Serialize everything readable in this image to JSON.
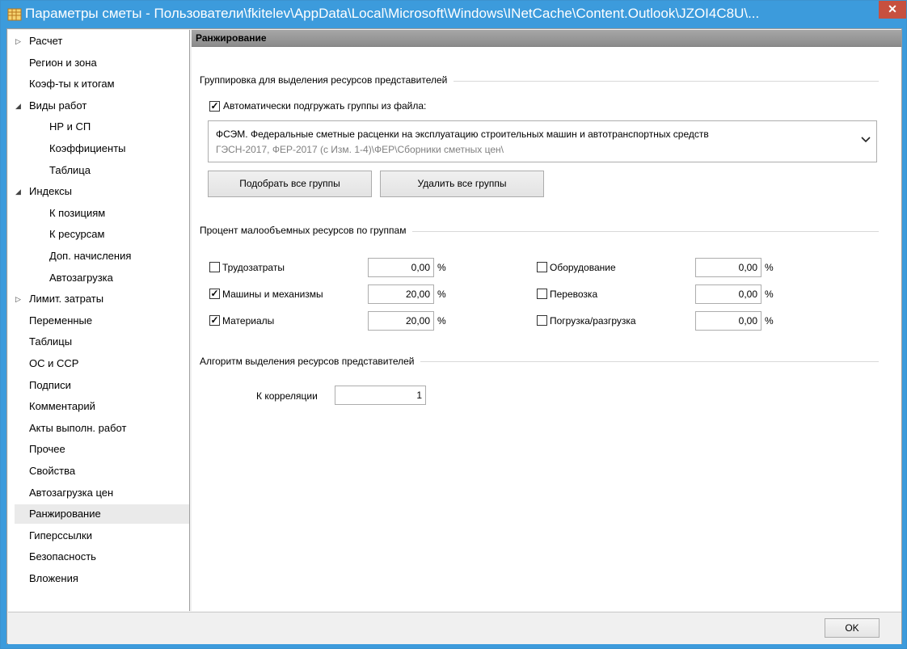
{
  "window": {
    "title": "Параметры сметы - Пользователи\\fkitelev\\AppData\\Local\\Microsoft\\Windows\\INetCache\\Content.Outlook\\JZOI4C8U\\...",
    "close_glyph": "✕",
    "app_icon": "table-app-icon",
    "accent_color": "#3c9bdc",
    "close_color": "#c7503f"
  },
  "nav": {
    "items": [
      {
        "label": "Расчет",
        "level": 0,
        "arrow": "▷"
      },
      {
        "label": "Регион и зона",
        "level": 0
      },
      {
        "label": "Коэф-ты к итогам",
        "level": 0
      },
      {
        "label": "Виды работ",
        "level": 0,
        "arrow": "◢"
      },
      {
        "label": "НР и СП",
        "level": 1
      },
      {
        "label": "Коэффициенты",
        "level": 1
      },
      {
        "label": "Таблица",
        "level": 1
      },
      {
        "label": "Индексы",
        "level": 0,
        "arrow": "◢"
      },
      {
        "label": "К позициям",
        "level": 1
      },
      {
        "label": "К ресурсам",
        "level": 1
      },
      {
        "label": "Доп. начисления",
        "level": 1
      },
      {
        "label": "Автозагрузка",
        "level": 1
      },
      {
        "label": "Лимит. затраты",
        "level": 0,
        "arrow": "▷"
      },
      {
        "label": "Переменные",
        "level": 0
      },
      {
        "label": "Таблицы",
        "level": 0
      },
      {
        "label": "ОС и ССР",
        "level": 0
      },
      {
        "label": "Подписи",
        "level": 0
      },
      {
        "label": "Комментарий",
        "level": 0
      },
      {
        "label": "Акты выполн. работ",
        "level": 0
      },
      {
        "label": "Прочее",
        "level": 0
      },
      {
        "label": "Свойства",
        "level": 0
      },
      {
        "label": "Автозагрузка цен",
        "level": 0
      },
      {
        "label": "Ранжирование",
        "level": 0,
        "selected": true
      },
      {
        "label": "Гиперссылки",
        "level": 0
      },
      {
        "label": "Безопасность",
        "level": 0
      },
      {
        "label": "Вложения",
        "level": 0
      }
    ]
  },
  "content": {
    "header": "Ранжирование",
    "grouping": {
      "label": "Группировка для выделения ресурсов представителей",
      "auto_load_label": "Автоматически подгружать группы из файла:",
      "auto_load_checked": true,
      "combo_main": "ФСЭМ. Федеральные сметные расценки на эксплуатацию строительных машин и автотранспортных средств",
      "combo_sub": "ГЭСН-2017, ФЕР-2017 (с Изм. 1-4)\\ФЕР\\Сборники сметных цен\\",
      "pick_all_button": "Подобрать все группы",
      "delete_all_button": "Удалить все группы"
    },
    "percent": {
      "label": "Процент малообъемных ресурсов по группам",
      "unit": "%",
      "rows": [
        {
          "label": "Трудозатраты",
          "checked": false,
          "value": "0,00"
        },
        {
          "label": "Машины и механизмы",
          "checked": true,
          "value": "20,00"
        },
        {
          "label": "Материалы",
          "checked": true,
          "value": "20,00"
        },
        {
          "label": "Оборудование",
          "checked": false,
          "value": "0,00"
        },
        {
          "label": "Перевозка",
          "checked": false,
          "value": "0,00"
        },
        {
          "label": "Погрузка/разгрузка",
          "checked": false,
          "value": "0,00"
        }
      ]
    },
    "algorithm": {
      "label": "Алгоритм выделения ресурсов представителей",
      "correlation_label": "К корреляции",
      "correlation_value": "1"
    }
  },
  "footer": {
    "ok_label": "OK"
  }
}
